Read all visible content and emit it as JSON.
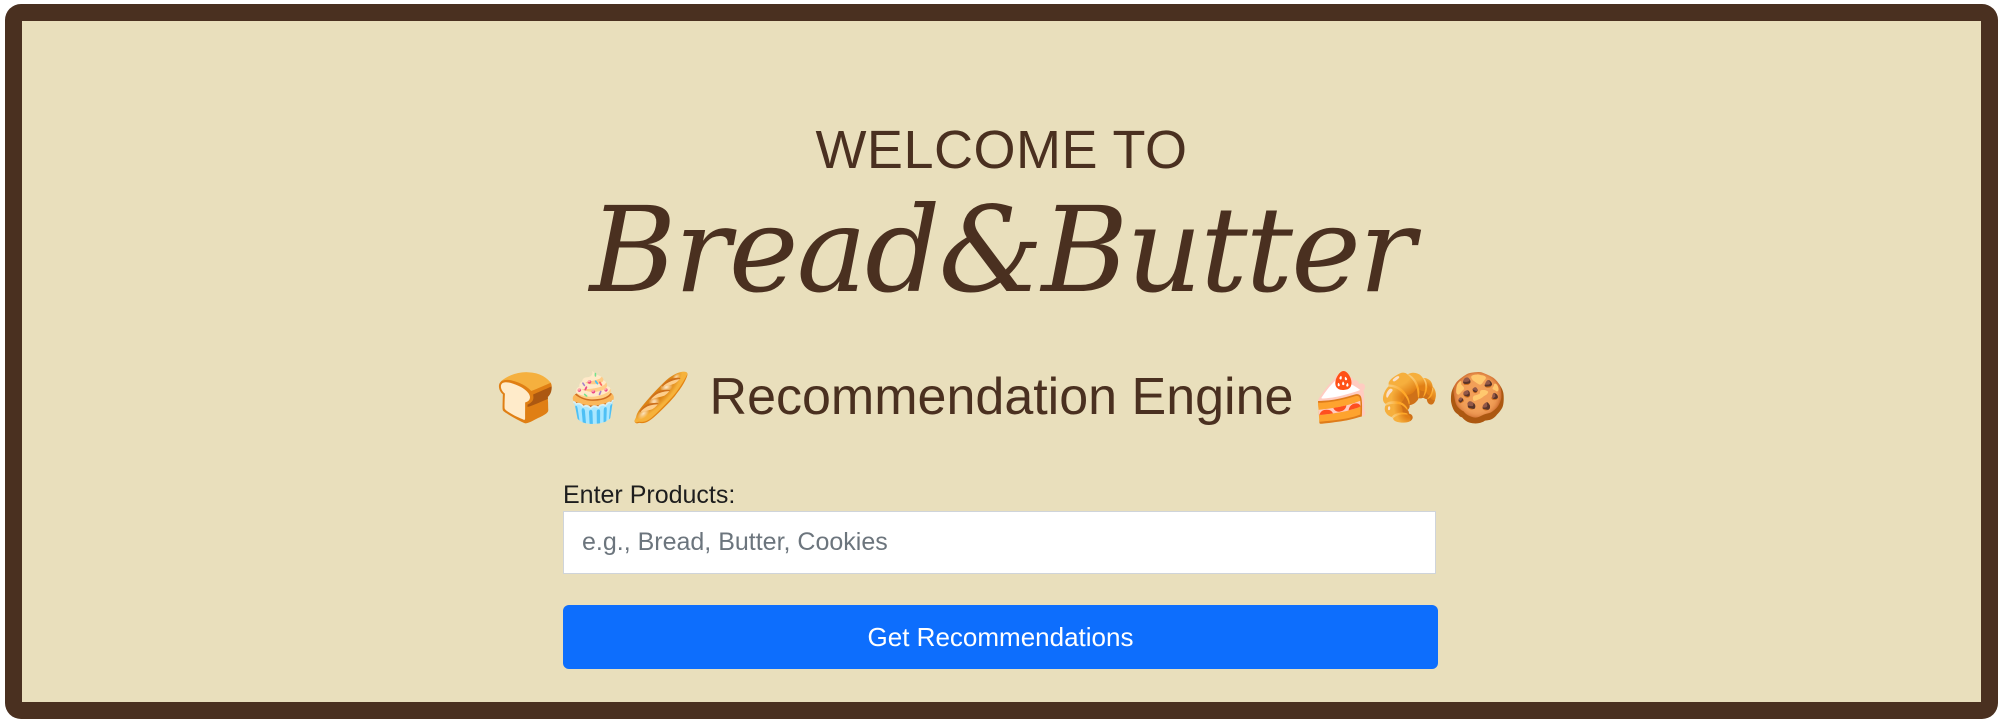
{
  "header": {
    "welcome": "WELCOME TO",
    "brand": "Bread&Butter",
    "subtitle": "Recommendation Engine",
    "emojis_left": [
      "🍞",
      "🧁",
      "🥖"
    ],
    "emojis_right": [
      "🍰",
      "🥐",
      "🍪"
    ]
  },
  "form": {
    "label": "Enter Products:",
    "input_value": "",
    "input_placeholder": "e.g., Bread, Butter, Cookies",
    "submit_label": "Get Recommendations"
  },
  "colors": {
    "background": "#e9dfbc",
    "border": "#4a3020",
    "text": "#4a3020",
    "button": "#0d6efd"
  }
}
